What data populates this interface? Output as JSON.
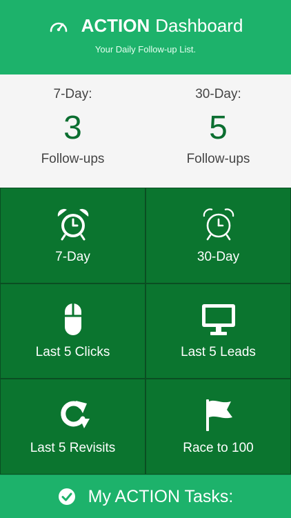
{
  "header": {
    "title_strong": "ACTION",
    "title_rest": "Dashboard",
    "subtitle": "Your Daily Follow-up List.",
    "icon": "speedometer-icon"
  },
  "stats": [
    {
      "period": "7-Day:",
      "count": "3",
      "unit": "Follow-ups"
    },
    {
      "period": "30-Day:",
      "count": "5",
      "unit": "Follow-ups"
    }
  ],
  "tiles": [
    {
      "label": "7-Day",
      "icon": "alarm-clock-icon"
    },
    {
      "label": "30-Day",
      "icon": "alarm-clock-outline-icon"
    },
    {
      "label": "Last 5 Clicks",
      "icon": "mouse-icon"
    },
    {
      "label": "Last 5 Leads",
      "icon": "monitor-icon"
    },
    {
      "label": "Last 5 Revisits",
      "icon": "refresh-icon"
    },
    {
      "label": "Race to 100",
      "icon": "flag-icon"
    }
  ],
  "footer": {
    "label": "My ACTION Tasks:",
    "icon": "check-circle-icon"
  },
  "colors": {
    "header_green": "#1db26b",
    "tile_green": "#0b752f",
    "number_green": "#0b6e30"
  }
}
